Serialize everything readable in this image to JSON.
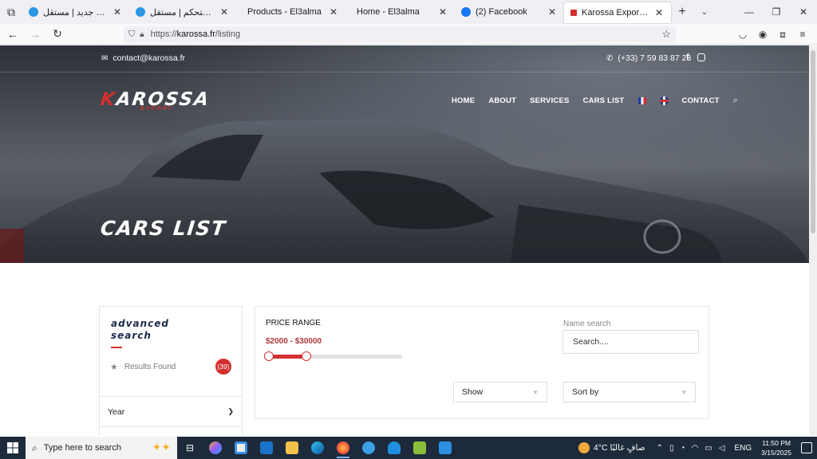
{
  "browser": {
    "tabs": [
      {
        "title": "إضافة عمل جديد | مستقل",
        "favicon_color": "#2b97e3",
        "active": false
      },
      {
        "title": "لوحة التحكم | مستقل",
        "favicon_color": "#2b97e3",
        "active": false
      },
      {
        "title": "Products - El3alma",
        "favicon_color": "",
        "active": false
      },
      {
        "title": "Home - El3alma",
        "favicon_color": "",
        "active": false
      },
      {
        "title": "(2) Facebook",
        "favicon_color": "#1877f2",
        "active": false
      },
      {
        "title": "Karossa Export - Cars List",
        "favicon_color": "#d32f2f",
        "active": true
      }
    ],
    "url_prefix": "https://",
    "url_host": "karossa.fr",
    "url_path": "/listing"
  },
  "site": {
    "topbar": {
      "email": "contact@karossa.fr",
      "phone": "(+33) 7 59 83 87 23"
    },
    "logo": {
      "brand_first": "K",
      "brand_rest": "AROSSA",
      "sub": "EXPORT"
    },
    "nav": [
      "HOME",
      "ABOUT",
      "SERVICES",
      "CARS LIST"
    ],
    "nav_contact": "CONTACT",
    "heading": "CARS LIST",
    "sidebar": {
      "title_line1": "advanced",
      "title_line2": "search",
      "results_label": "Results Found",
      "results_count": "(39)",
      "year_label": "Year"
    },
    "filters": {
      "price_label": "PRICE RANGE",
      "price_range": "$2000 - $30000",
      "slider_min_fraction": 0,
      "slider_max_fraction": 0.28,
      "name_label": "Name search",
      "name_placeholder": "Search....",
      "show_label": "Show",
      "sort_label": "Sort by"
    },
    "colors": {
      "accent": "#d32f2f",
      "brand_navy": "#1d2a4a"
    }
  },
  "taskbar": {
    "search_placeholder": "Type here to search",
    "weather": "4°C  صافٍ غالبًا",
    "lang": "ENG",
    "time": "11:50 PM",
    "date": "3/15/2025"
  }
}
